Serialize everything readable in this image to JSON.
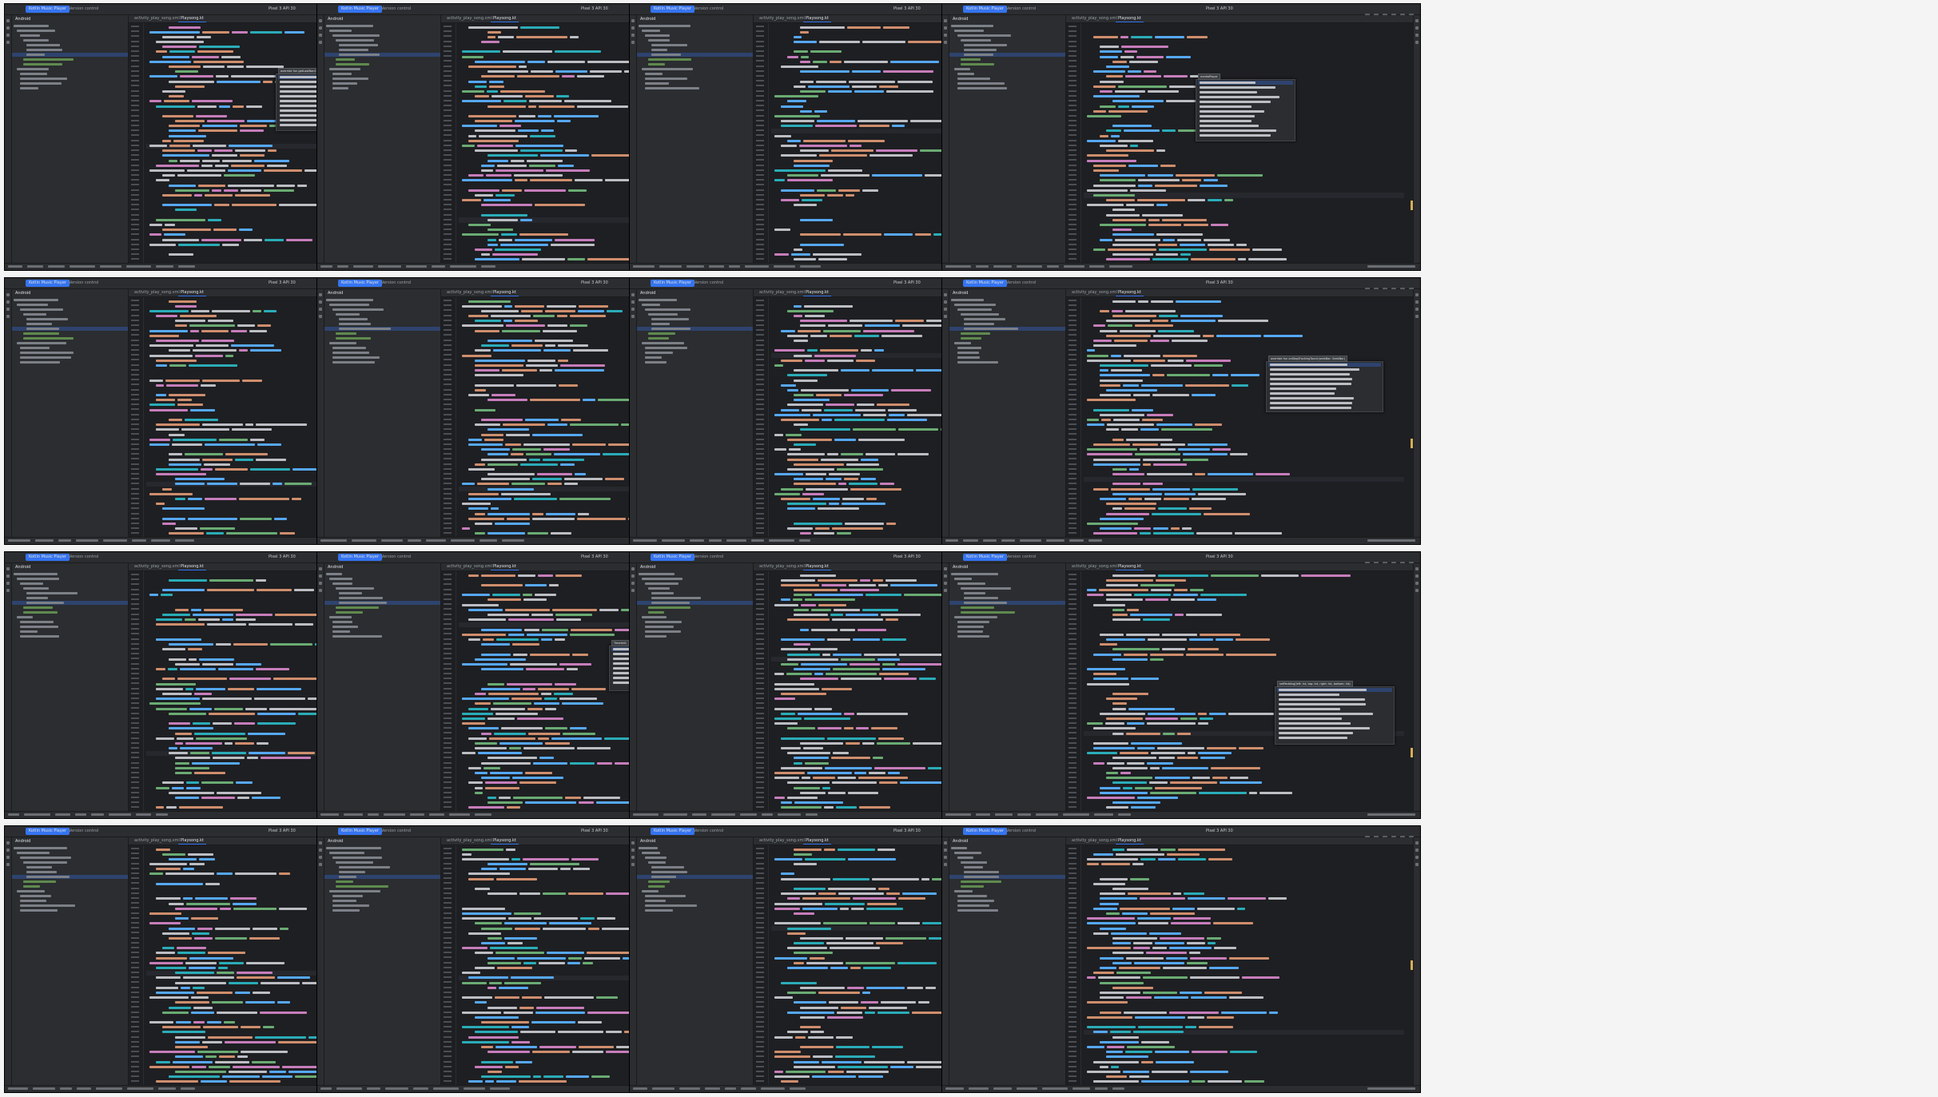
{
  "ide": {
    "project_name": "Kotlin Music Player",
    "vcs_label": "Version control",
    "device_label": "Pixel 3 API 30",
    "run_config": "app",
    "tab_file": "Playsong.kt",
    "tab_layout": "activity_play_song.xml",
    "project_header": "Android",
    "package_line": "package com.developer.kotlinmusicplayer",
    "class_decl": "class Playsong : AppCompatActivity() {"
  },
  "frames": [
    {
      "id": 1,
      "tab": "Playsong.kt",
      "has_popup": true,
      "popup_title": "override fun getLastNonConfigurationInstance()"
    },
    {
      "id": 2,
      "tab": "Playsong.kt",
      "has_popup": false
    },
    {
      "id": 3,
      "tab": "Playsong.kt",
      "has_popup": false
    },
    {
      "id": 4,
      "tab": "Playsong.kt",
      "has_popup": true,
      "popup_title": "mediaPlayer"
    },
    {
      "id": 5,
      "tab": "Playsong.kt",
      "has_popup": false
    },
    {
      "id": 6,
      "tab": "Playsong.kt",
      "has_popup": false
    },
    {
      "id": 7,
      "tab": "Playsong.kt",
      "has_popup": true,
      "popup_title": "toMinutes(duration: Long)"
    },
    {
      "id": 8,
      "tab": "Playsong.kt",
      "has_popup": true,
      "popup_title": "override fun onStopTrackingTouch(seekBar: SeekBar)"
    },
    {
      "id": 9,
      "tab": "Playsong.kt",
      "has_popup": false
    },
    {
      "id": 10,
      "tab": "Playsong.kt",
      "has_popup": true,
      "popup_title": "TimeUnit"
    },
    {
      "id": 11,
      "tab": "Playsong.kt",
      "has_popup": false
    },
    {
      "id": 12,
      "tab": "Playsong.kt",
      "has_popup": true,
      "popup_title": "setPadding(left: Int, top: Int, right: Int, bottom: Int)"
    },
    {
      "id": 13,
      "tab": "Playsong.kt",
      "has_popup": false
    },
    {
      "id": 14,
      "tab": "Playsong.kt",
      "has_popup": false
    },
    {
      "id": 15,
      "tab": "Playsong.kt",
      "has_popup": false
    },
    {
      "id": 16,
      "tab": "Playsong.kt",
      "has_popup": false
    }
  ],
  "colors": {
    "editor_bg": "#1e1f22",
    "panel_bg": "#2b2d30",
    "accent": "#3574f0",
    "keyword": "#cf8e6d",
    "function": "#56a8f5",
    "string": "#6aab73",
    "property": "#c77dbb",
    "number": "#2aacb8"
  }
}
